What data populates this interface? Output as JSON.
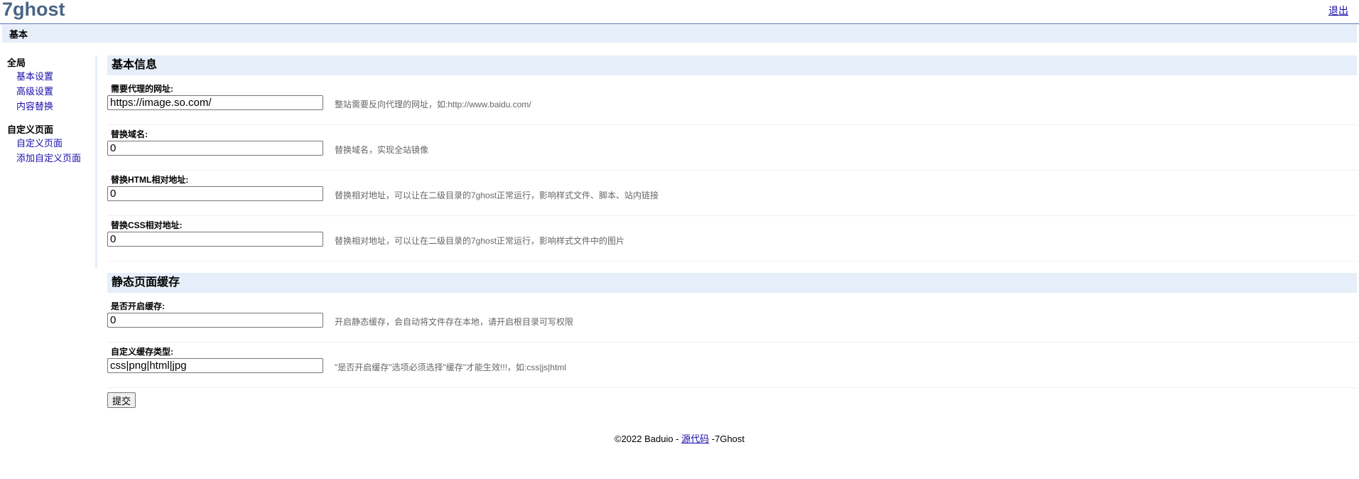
{
  "header": {
    "logo": "7ghost",
    "logout": "退出"
  },
  "tabs": [
    {
      "label": "基本"
    }
  ],
  "sidebar": {
    "groups": [
      {
        "title": "全局",
        "items": [
          {
            "label": "基本设置"
          },
          {
            "label": "高级设置"
          },
          {
            "label": "内容替换"
          }
        ]
      },
      {
        "title": "自定义页面",
        "items": [
          {
            "label": "自定义页面"
          },
          {
            "label": "添加自定义页面"
          }
        ]
      }
    ]
  },
  "sections": [
    {
      "title": "基本信息",
      "fields": [
        {
          "label": "需要代理的网址:",
          "value": "https://image.so.com/",
          "hint": "整站需要反向代理的网址，如:http://www.baidu.com/"
        },
        {
          "label": "替换域名:",
          "value": "0",
          "hint": "替换域名，实现全站镜像"
        },
        {
          "label": "替换HTML相对地址:",
          "value": "0",
          "hint": "替换相对地址，可以让在二级目录的7ghost正常运行，影响样式文件、脚本、站内链接"
        },
        {
          "label": "替换CSS相对地址:",
          "value": "0",
          "hint": "替换相对地址，可以让在二级目录的7ghost正常运行，影响样式文件中的图片"
        }
      ]
    },
    {
      "title": "静态页面缓存",
      "fields": [
        {
          "label": "是否开启缓存:",
          "value": "0",
          "hint": "开启静态缓存，会自动将文件存在本地，请开启根目录可写权限"
        },
        {
          "label": "自定义缓存类型:",
          "value": "css|png|html|jpg",
          "hint": "\"是否开启缓存\"选项必须选择\"缓存\"才能生效!!!，如:css|js|html"
        }
      ]
    }
  ],
  "submit_label": "提交",
  "footer": {
    "prefix": "©2022 Baduio - ",
    "link": "源代码",
    "suffix": " -7Ghost"
  }
}
